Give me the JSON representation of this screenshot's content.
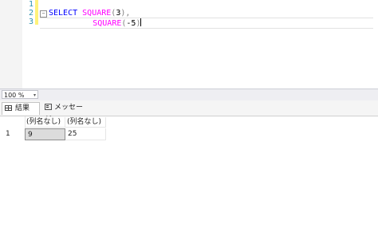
{
  "editor": {
    "line_numbers": [
      "1",
      "2",
      "3"
    ],
    "lines": {
      "l2": {
        "kw": "SELECT",
        "fn": "SQUARE",
        "open": "(",
        "arg": "3",
        "close": ")",
        "comma": ","
      },
      "l3": {
        "fn": "SQUARE",
        "open": "(",
        "arg": "-5",
        "close": ")"
      }
    },
    "collapse_symbol": "−"
  },
  "zoom": {
    "value": "100 %",
    "arrow": "▾"
  },
  "tabs": {
    "results": "結果",
    "messages": "メッセージ"
  },
  "grid": {
    "columns": [
      "(列名なし)",
      "(列名なし)"
    ],
    "rows": [
      {
        "num": "1",
        "cells": [
          "9",
          "25"
        ]
      }
    ]
  },
  "colors": {
    "keyword": "#0000ff",
    "function": "#ff00ff",
    "line_number": "#2b91af",
    "change_bar": "#fff27a"
  }
}
